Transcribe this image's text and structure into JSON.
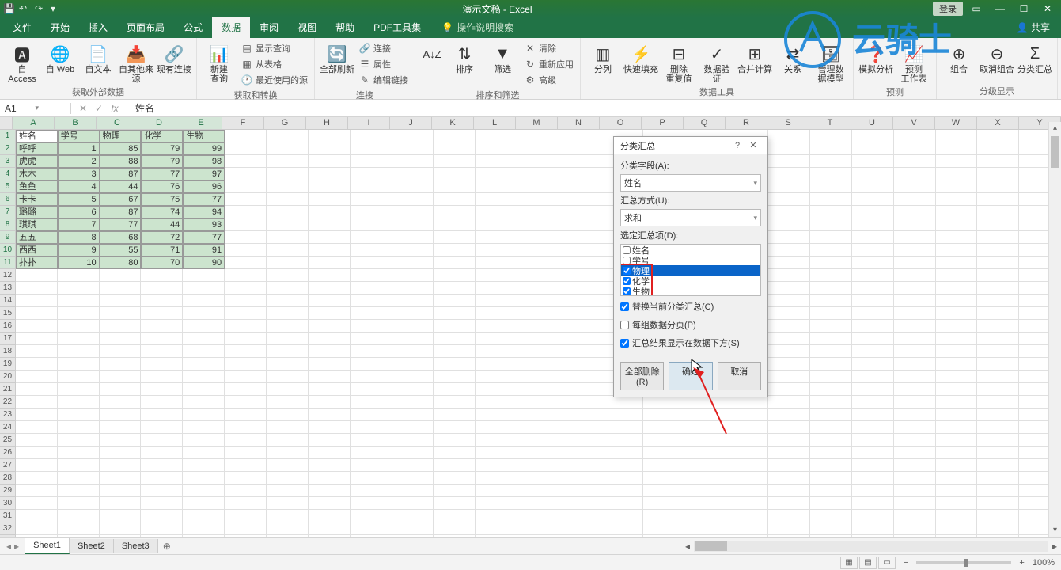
{
  "titlebar": {
    "title": "演示文稿 - Excel",
    "login": "登录"
  },
  "tabs": [
    "文件",
    "开始",
    "插入",
    "页面布局",
    "公式",
    "数据",
    "审阅",
    "视图",
    "帮助",
    "PDF工具集"
  ],
  "active_tab": 5,
  "tell_me": "操作说明搜索",
  "share": "共享",
  "ribbon": {
    "g1": {
      "label": "获取外部数据",
      "btns": [
        "自 Access",
        "自 Web",
        "自文本",
        "自其他来源",
        "现有连接"
      ]
    },
    "g2": {
      "label": "获取和转换",
      "btns": [
        "新建\n查询"
      ],
      "stack": [
        "显示查询",
        "从表格",
        "最近使用的源"
      ]
    },
    "g3": {
      "label": "连接",
      "btns": [
        "全部刷新"
      ],
      "stack": [
        "连接",
        "属性",
        "编辑链接"
      ]
    },
    "g4": {
      "label": "排序和筛选",
      "btns": [
        "排序",
        "筛选"
      ],
      "stack": [
        "清除",
        "重新应用",
        "高级"
      ]
    },
    "g5": {
      "label": "数据工具",
      "btns": [
        "分列",
        "快速填充",
        "删除\n重复值",
        "数据验\n证",
        "合并计算",
        "关系",
        "管理数\n据模型"
      ]
    },
    "g6": {
      "label": "预测",
      "btns": [
        "模拟分析",
        "预测\n工作表"
      ]
    },
    "g7": {
      "label": "分级显示",
      "btns": [
        "组合",
        "取消组合",
        "分类汇总"
      ]
    }
  },
  "formula_bar": {
    "name": "A1",
    "value": "姓名"
  },
  "columns": [
    "A",
    "B",
    "C",
    "D",
    "E",
    "F",
    "G",
    "H",
    "I",
    "J",
    "K",
    "L",
    "M",
    "N",
    "O",
    "P",
    "Q",
    "R",
    "S",
    "T",
    "U",
    "V",
    "W",
    "X",
    "Y"
  ],
  "headers": [
    "姓名",
    "学号",
    "物理",
    "化学",
    "生物"
  ],
  "rows": [
    [
      "呼呼",
      "1",
      "85",
      "79",
      "99"
    ],
    [
      "虎虎",
      "2",
      "88",
      "79",
      "98"
    ],
    [
      "木木",
      "3",
      "87",
      "77",
      "97"
    ],
    [
      "鱼鱼",
      "4",
      "44",
      "76",
      "96"
    ],
    [
      "卡卡",
      "5",
      "67",
      "75",
      "77"
    ],
    [
      "璐璐",
      "6",
      "87",
      "74",
      "94"
    ],
    [
      "琪琪",
      "7",
      "77",
      "44",
      "93"
    ],
    [
      "五五",
      "8",
      "68",
      "72",
      "77"
    ],
    [
      "西西",
      "9",
      "55",
      "71",
      "91"
    ],
    [
      "扑扑",
      "10",
      "80",
      "70",
      "90"
    ]
  ],
  "sheets": [
    "Sheet1",
    "Sheet2",
    "Sheet3"
  ],
  "zoom": "100%",
  "dialog": {
    "title": "分类汇总",
    "field_label": "分类字段(A):",
    "field_value": "姓名",
    "method_label": "汇总方式(U):",
    "method_value": "求和",
    "items_label": "选定汇总项(D):",
    "items": [
      {
        "label": "姓名",
        "checked": false,
        "hl": false
      },
      {
        "label": "学号",
        "checked": false,
        "hl": false
      },
      {
        "label": "物理",
        "checked": true,
        "hl": true
      },
      {
        "label": "化学",
        "checked": true,
        "hl": false
      },
      {
        "label": "生物",
        "checked": true,
        "hl": false
      }
    ],
    "chk1": "替换当前分类汇总(C)",
    "chk2": "每组数据分页(P)",
    "chk3": "汇总结果显示在数据下方(S)",
    "btn_remove": "全部删除(R)",
    "btn_ok": "确定",
    "btn_cancel": "取消"
  },
  "watermark": "云骑士"
}
